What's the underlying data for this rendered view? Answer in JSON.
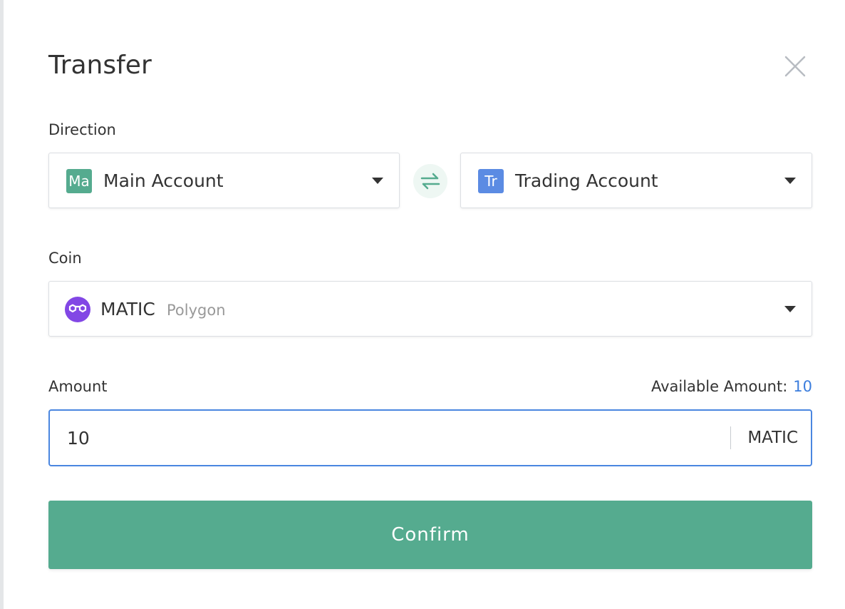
{
  "modal": {
    "title": "Transfer",
    "close_icon": "close-icon"
  },
  "direction": {
    "label": "Direction",
    "from": {
      "badge": "Ma",
      "name": "Main Account",
      "badge_color": "#55ab8f"
    },
    "to": {
      "badge": "Tr",
      "name": "Trading Account",
      "badge_color": "#5b8be3"
    },
    "swap_icon": "swap-arrows-icon"
  },
  "coin": {
    "label": "Coin",
    "symbol": "MATIC",
    "name": "Polygon",
    "icon": "polygon-icon",
    "icon_color": "#8247e5"
  },
  "amount": {
    "label": "Amount",
    "available_label": "Available Amount:",
    "available_value": "10",
    "value": "10",
    "unit": "MATIC"
  },
  "confirm": {
    "label": "Confirm"
  },
  "colors": {
    "accent": "#55ab8f",
    "link": "#3b7ddd",
    "focus_border": "#4a86e0"
  }
}
